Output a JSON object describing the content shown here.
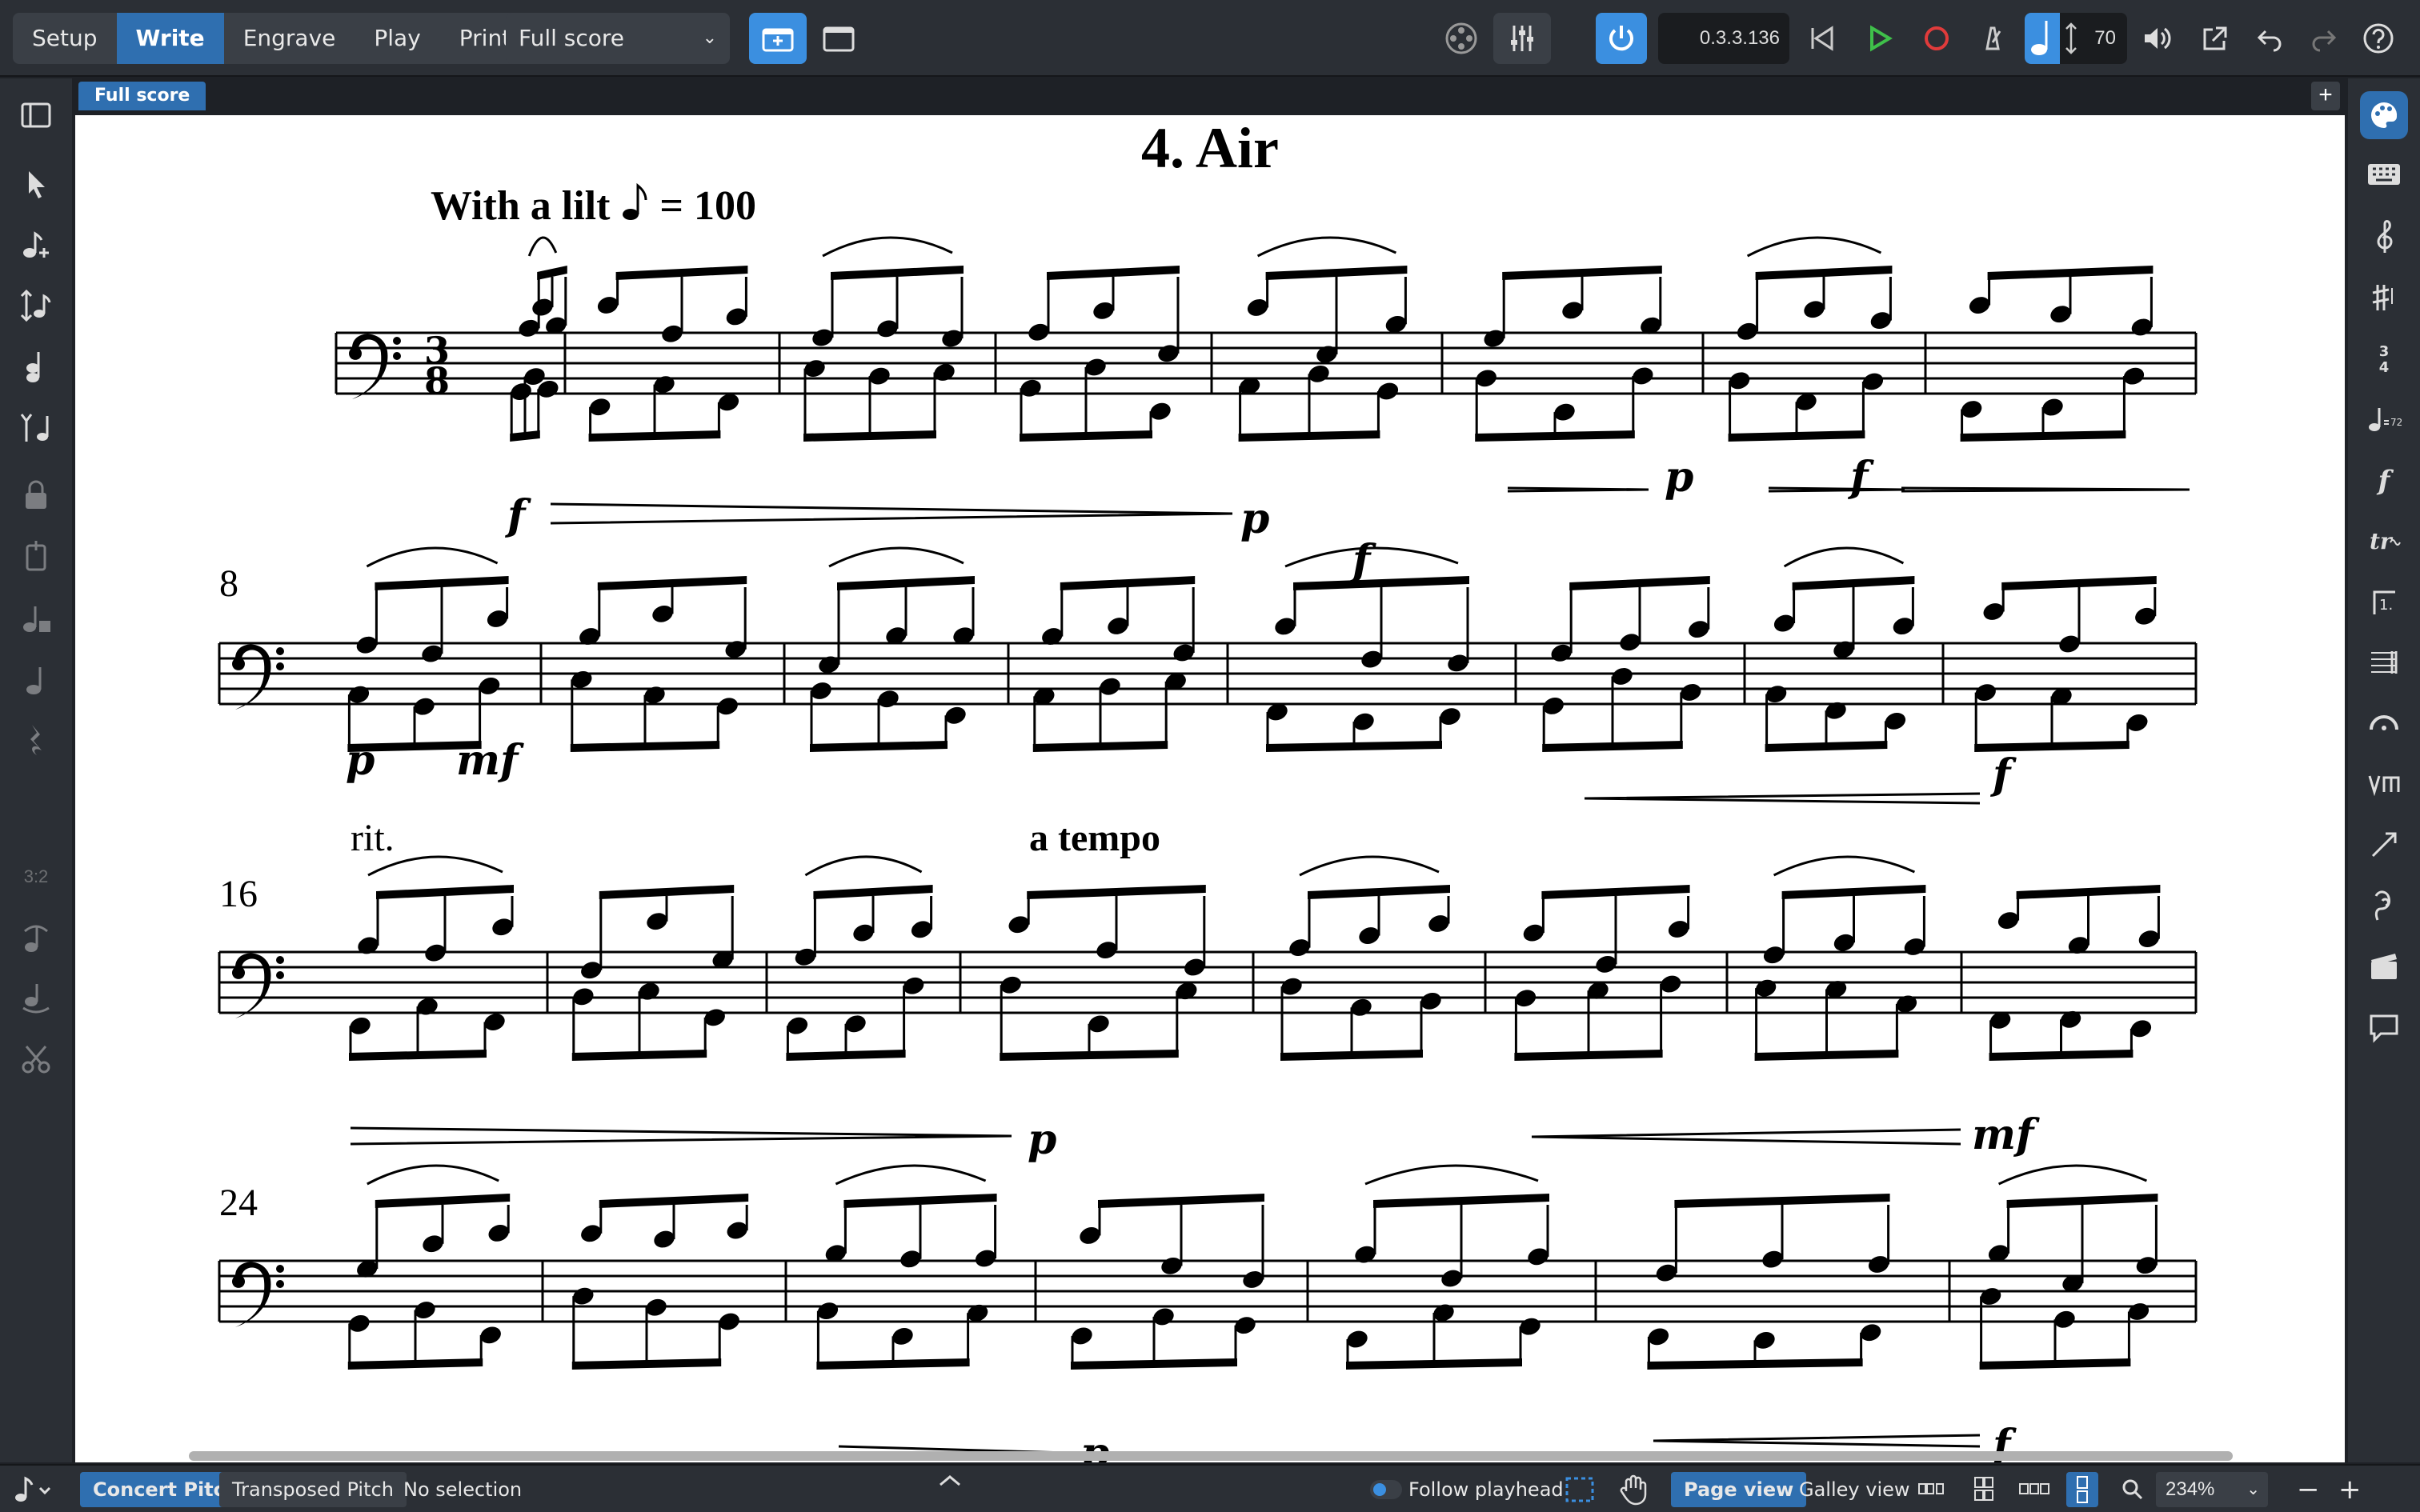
{
  "toolbar": {
    "modes": [
      "Setup",
      "Write",
      "Engrave",
      "Play",
      "Print"
    ],
    "active_mode": "Write",
    "layout": "Full score",
    "timecode": "0.3.3.136",
    "metronome_value": "70",
    "accent_color": "#2f6fb0"
  },
  "tabs": {
    "active": "Full score"
  },
  "left_tools": [
    "select-icon",
    "note-input-icon",
    "insert-mode-icon",
    "chords-icon",
    "grace-notes-icon",
    "lock-duration-icon",
    "force-duration-icon",
    "tuplet-icon",
    "rest-icon",
    "slur-icon",
    "tie-icon",
    "scissors-icon"
  ],
  "left_tuplet_label": "3:2",
  "right_tools": [
    "palette-icon",
    "keyboard-icon",
    "clef-icon",
    "key-signature-icon",
    "time-signature-icon",
    "tempo-icon",
    "dynamics-icon",
    "ornaments-icon",
    "repeat-icon",
    "bars-icon",
    "holds-icon",
    "playing-techniques-icon",
    "lines-icon",
    "harp-icon",
    "cue-icon",
    "comment-icon"
  ],
  "score": {
    "title": "4. Air",
    "tempo_text": "With a lilt",
    "tempo_eq": "= 100",
    "bar_numbers": [
      "8",
      "16",
      "24"
    ],
    "rit": "rit.",
    "a_tempo": "a tempo",
    "dynamics": {
      "s1_f": "f",
      "s1_p": "p",
      "s1_f2": "f",
      "s2_f": "f",
      "s2_p": "p",
      "s2_p2": "p",
      "s2_mf": "mf",
      "s3_f": "f",
      "s4_p": "p",
      "s4_mf": "mf",
      "s5_f": "f",
      "s5_p": "p"
    }
  },
  "status": {
    "concert_pitch": "Concert Pitch",
    "transposed_pitch": "Transposed Pitch",
    "selection": "No selection",
    "follow_playhead": "Follow playhead",
    "page_view": "Page view",
    "galley_view": "Galley view",
    "zoom": "234%"
  }
}
